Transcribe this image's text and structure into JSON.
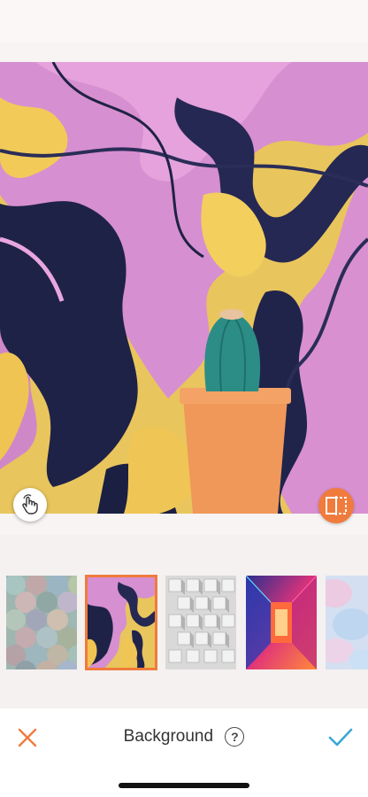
{
  "toolbar": {
    "title": "Background",
    "help_icon": "?",
    "close_icon": "close-icon",
    "confirm_icon": "checkmark-icon"
  },
  "canvas": {
    "hand_icon": "hand-gesture-icon",
    "compare_icon": "compare-icon"
  },
  "backgrounds": [
    {
      "name": "pastel-scales",
      "selected": false
    },
    {
      "name": "pink-marble",
      "selected": true
    },
    {
      "name": "white-cubes",
      "selected": false
    },
    {
      "name": "neon-corridor",
      "selected": false
    },
    {
      "name": "watercolor",
      "selected": false
    }
  ],
  "colors": {
    "accent": "#f07b3c",
    "confirm": "#3aa7d8",
    "pink": "#d88fce",
    "navy": "#1f2344",
    "yellow": "#f1ca58"
  }
}
